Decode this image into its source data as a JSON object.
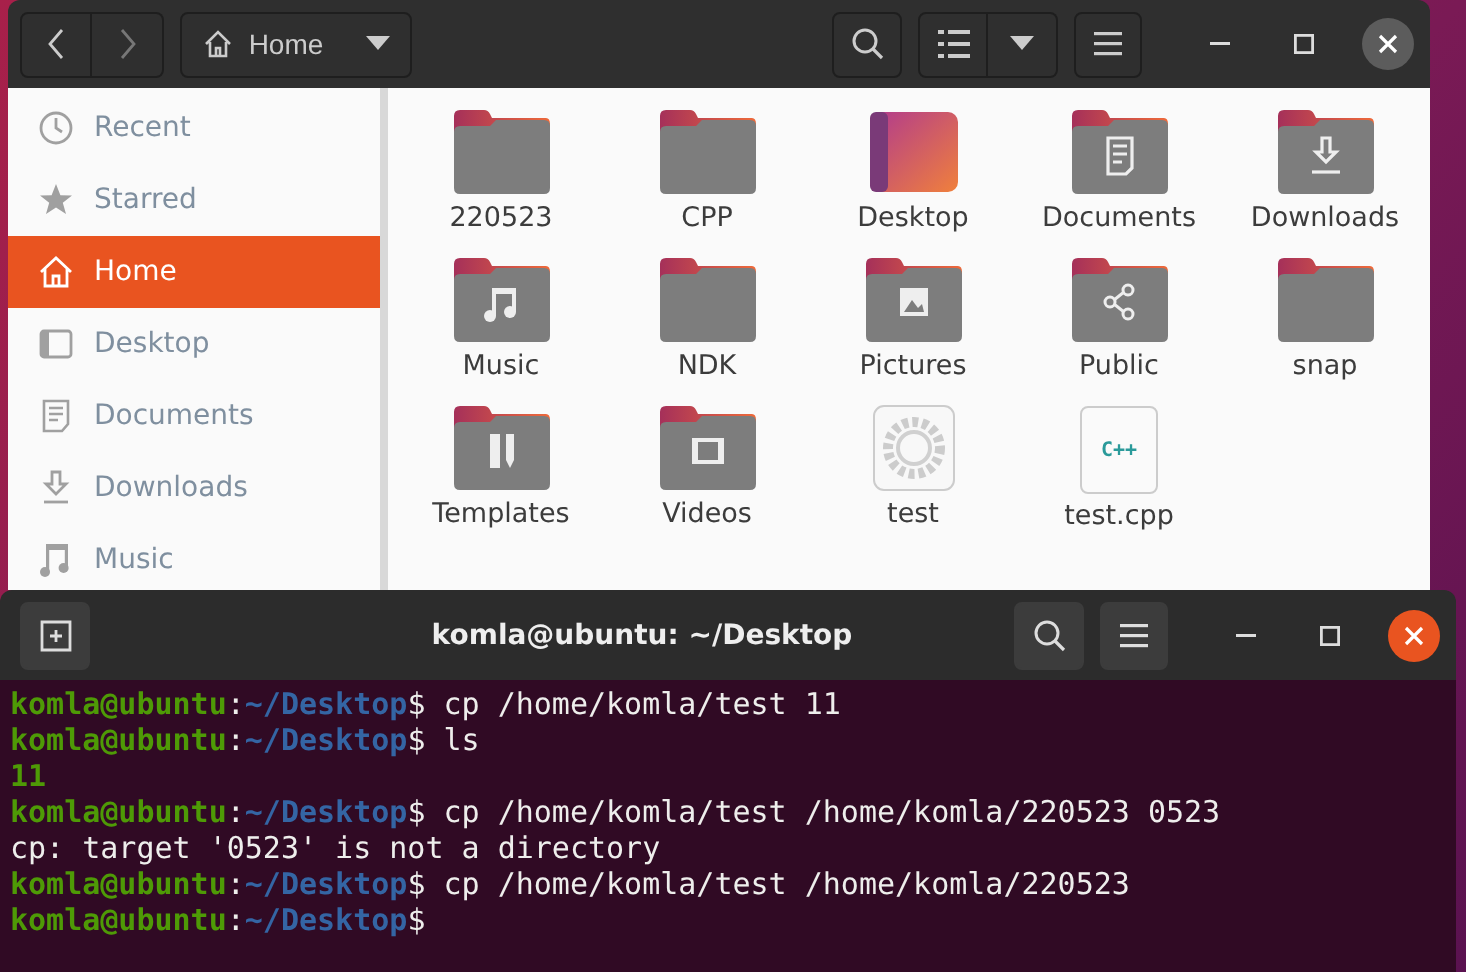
{
  "files_window": {
    "path_button": "Home",
    "sidebar": [
      {
        "label": "Recent",
        "selected": false
      },
      {
        "label": "Starred",
        "selected": false
      },
      {
        "label": "Home",
        "selected": true
      },
      {
        "label": "Desktop",
        "selected": false
      },
      {
        "label": "Documents",
        "selected": false
      },
      {
        "label": "Downloads",
        "selected": false
      },
      {
        "label": "Music",
        "selected": false
      }
    ],
    "items": [
      {
        "name": "220523",
        "kind": "folder"
      },
      {
        "name": "CPP",
        "kind": "folder"
      },
      {
        "name": "Desktop",
        "kind": "desktop"
      },
      {
        "name": "Documents",
        "kind": "folder"
      },
      {
        "name": "Downloads",
        "kind": "folder"
      },
      {
        "name": "Music",
        "kind": "folder"
      },
      {
        "name": "NDK",
        "kind": "folder"
      },
      {
        "name": "Pictures",
        "kind": "folder"
      },
      {
        "name": "Public",
        "kind": "folder"
      },
      {
        "name": "snap",
        "kind": "folder"
      },
      {
        "name": "Templates",
        "kind": "folder"
      },
      {
        "name": "Videos",
        "kind": "folder"
      },
      {
        "name": "test",
        "kind": "executable"
      },
      {
        "name": "test.cpp",
        "kind": "source",
        "badge": "C++"
      }
    ]
  },
  "terminal": {
    "title": "komla@ubuntu: ~/Desktop",
    "lines": [
      {
        "kind": "prompt",
        "user": "komla@ubuntu",
        "separator": ":",
        "path": "~/Desktop",
        "command": "$ cp /home/komla/test 11"
      },
      {
        "kind": "prompt",
        "user": "komla@ubuntu",
        "separator": ":",
        "path": "~/Desktop",
        "command": "$ ls"
      },
      {
        "kind": "file",
        "text": "11"
      },
      {
        "kind": "prompt",
        "user": "komla@ubuntu",
        "separator": ":",
        "path": "~/Desktop",
        "command": "$ cp /home/komla/test /home/komla/220523 0523"
      },
      {
        "kind": "message",
        "text": "cp: target '0523' is not a directory"
      },
      {
        "kind": "prompt",
        "user": "komla@ubuntu",
        "separator": ":",
        "path": "~/Desktop",
        "command": "$ cp /home/komla/test /home/komla/220523"
      },
      {
        "kind": "prompt",
        "user": "komla@ubuntu",
        "separator": ":",
        "path": "~/Desktop",
        "command": "$"
      }
    ]
  }
}
